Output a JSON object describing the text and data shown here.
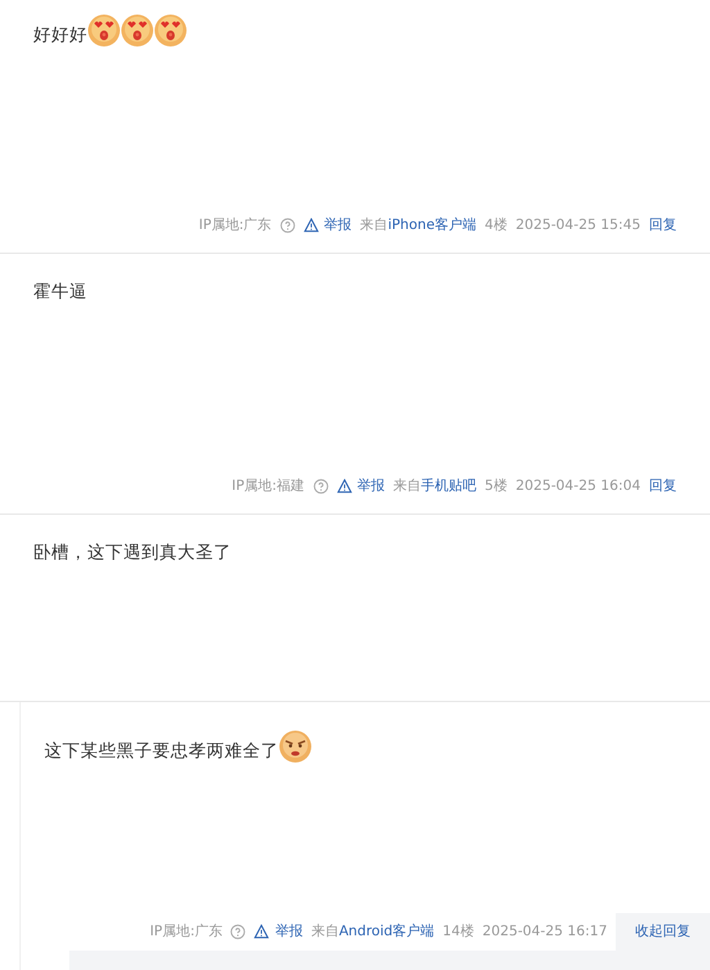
{
  "posts": [
    {
      "text": "好好好",
      "emojis": [
        {
          "kind": "heart-eyes"
        },
        {
          "kind": "heart-eyes"
        },
        {
          "kind": "heart-eyes"
        }
      ],
      "footer": {
        "location": "IP属地:广东",
        "report": "举报",
        "source_prefix": "来自",
        "source": "iPhone客户端",
        "floor": "4楼",
        "time": "2025-04-25 15:45",
        "reply": "回复",
        "reply_expanded": false
      }
    },
    {
      "text": "霍牛逼",
      "footer": {
        "location": "IP属地:福建",
        "report": "举报",
        "source_prefix": "来自",
        "source": "手机贴吧",
        "floor": "5楼",
        "time": "2025-04-25 16:04",
        "reply": "回复",
        "reply_expanded": false
      }
    },
    {
      "text": "卧槽，这下遇到真大圣了"
    },
    {
      "text": "这下某些黑子要忠孝两难全了",
      "emojis": [
        {
          "kind": "angry"
        }
      ],
      "footer": {
        "location": "IP属地:广东",
        "report": "举报",
        "source_prefix": "来自",
        "source": "Android客户端",
        "floor": "14楼",
        "time": "2025-04-25 16:17",
        "reply": "收起回复",
        "reply_expanded": true
      }
    }
  ]
}
